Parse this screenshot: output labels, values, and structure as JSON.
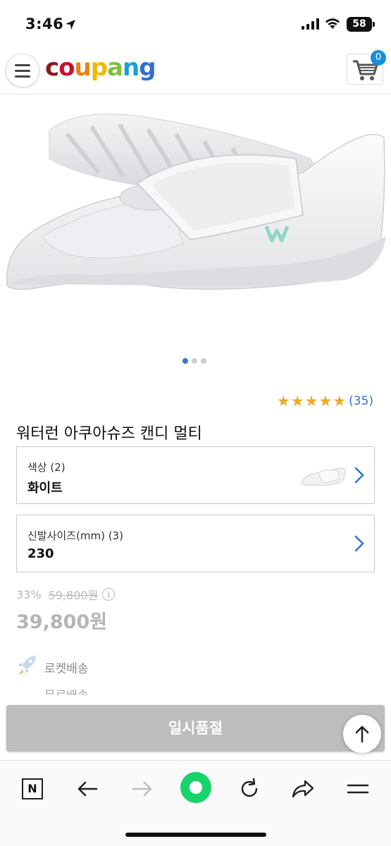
{
  "status_bar": {
    "time": "3:46",
    "battery": "58"
  },
  "header": {
    "logo": [
      "c",
      "o",
      "u",
      "p",
      "a",
      "n",
      "g"
    ],
    "logo_colors": [
      "#8b1a1a",
      "#c8102e",
      "#e8821a",
      "#f2b705",
      "#7cc142",
      "#1a9fd8",
      "#2f6fd1"
    ],
    "cart_count": "0"
  },
  "product": {
    "title": "워터런 아쿠아슈즈 캔디 멀티",
    "rating_stars": 5,
    "review_count": "(35)",
    "image_dots": 3,
    "active_dot": 0
  },
  "options": [
    {
      "label": "색상 (2)",
      "value": "화이트"
    },
    {
      "label": "신발사이즈(mm) (3)",
      "value": "230"
    }
  ],
  "price": {
    "discount": "33%",
    "original": "59,800원",
    "sale": "39,800원"
  },
  "delivery": {
    "type": "로켓배송",
    "shipping": "무료배송"
  },
  "actions": {
    "soldout_label": "일시품절"
  },
  "colors": {
    "accent_blue": "#1a8dd8",
    "star": "#f5a623",
    "soldout_bg": "#bdbdbd",
    "naver_green": "#17d46a"
  }
}
